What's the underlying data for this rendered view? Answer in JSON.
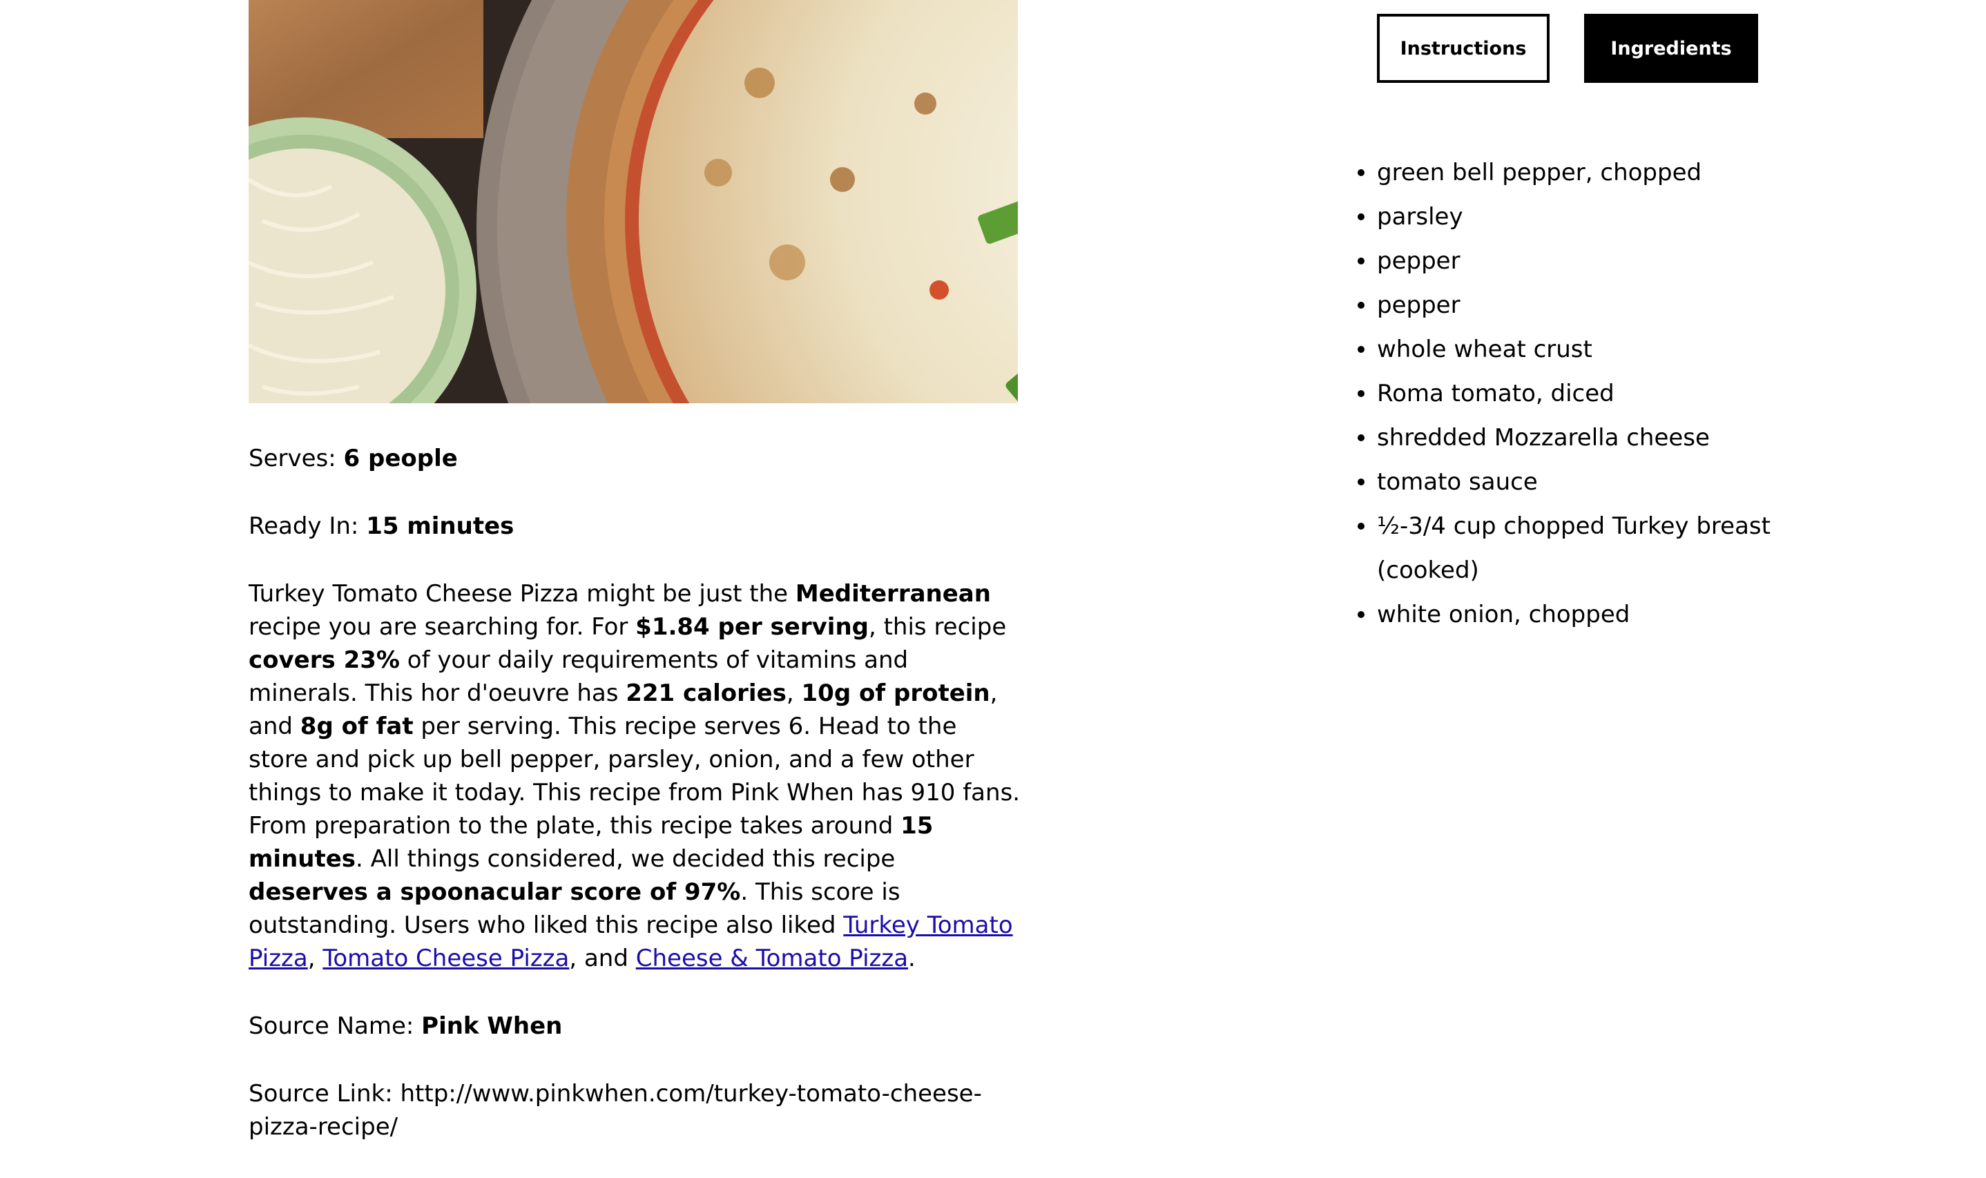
{
  "tabs": {
    "instructions": "Instructions",
    "ingredients": "Ingredients"
  },
  "recipe": {
    "image_alt": "Turkey Tomato Cheese Pizza",
    "serves_label": "Serves: ",
    "serves_value": "6 people",
    "ready_label": "Ready In: ",
    "ready_value": "15 minutes",
    "summary": {
      "t1": "Turkey Tomato Cheese Pizza might be just the ",
      "b1": "Mediterranean",
      "t2": " recipe you are searching for. For ",
      "b2": "$1.84 per serving",
      "t3": ", this recipe ",
      "b3": "covers 23%",
      "t4": " of your daily requirements of vitamins and minerals. This hor d'oeuvre has ",
      "b4": "221 calories",
      "t5": ", ",
      "b5": "10g of protein",
      "t6": ", and ",
      "b6": "8g of fat",
      "t7": " per serving. This recipe serves 6. Head to the store and pick up bell pepper, parsley, onion, and a few other things to make it today. This recipe from Pink When has 910 fans. From preparation to the plate, this recipe takes around ",
      "b7": "15 minutes",
      "t8": ". All things considered, we decided this recipe ",
      "b8": "deserves a spoonacular score of 97%",
      "t9": ". This score is outstanding. Users who liked this recipe also liked ",
      "link1": "Turkey Tomato Pizza",
      "t10": ", ",
      "link2": "Tomato Cheese Pizza",
      "t11": ", and ",
      "link3": "Cheese & Tomato Pizza",
      "t12": "."
    },
    "source_name_label": "Source Name: ",
    "source_name_value": "Pink When",
    "source_link_label": "Source Link: ",
    "source_link_value": "http://www.pinkwhen.com/turkey-tomato-cheese-pizza-recipe/"
  },
  "ingredients": [
    "green bell pepper, chopped",
    "parsley",
    "pepper",
    "pepper",
    "whole wheat crust",
    "Roma tomato, diced",
    "shredded Mozzarella cheese",
    "tomato sauce",
    "½-3/4 cup chopped Turkey breast (cooked)",
    "white onion, chopped"
  ]
}
